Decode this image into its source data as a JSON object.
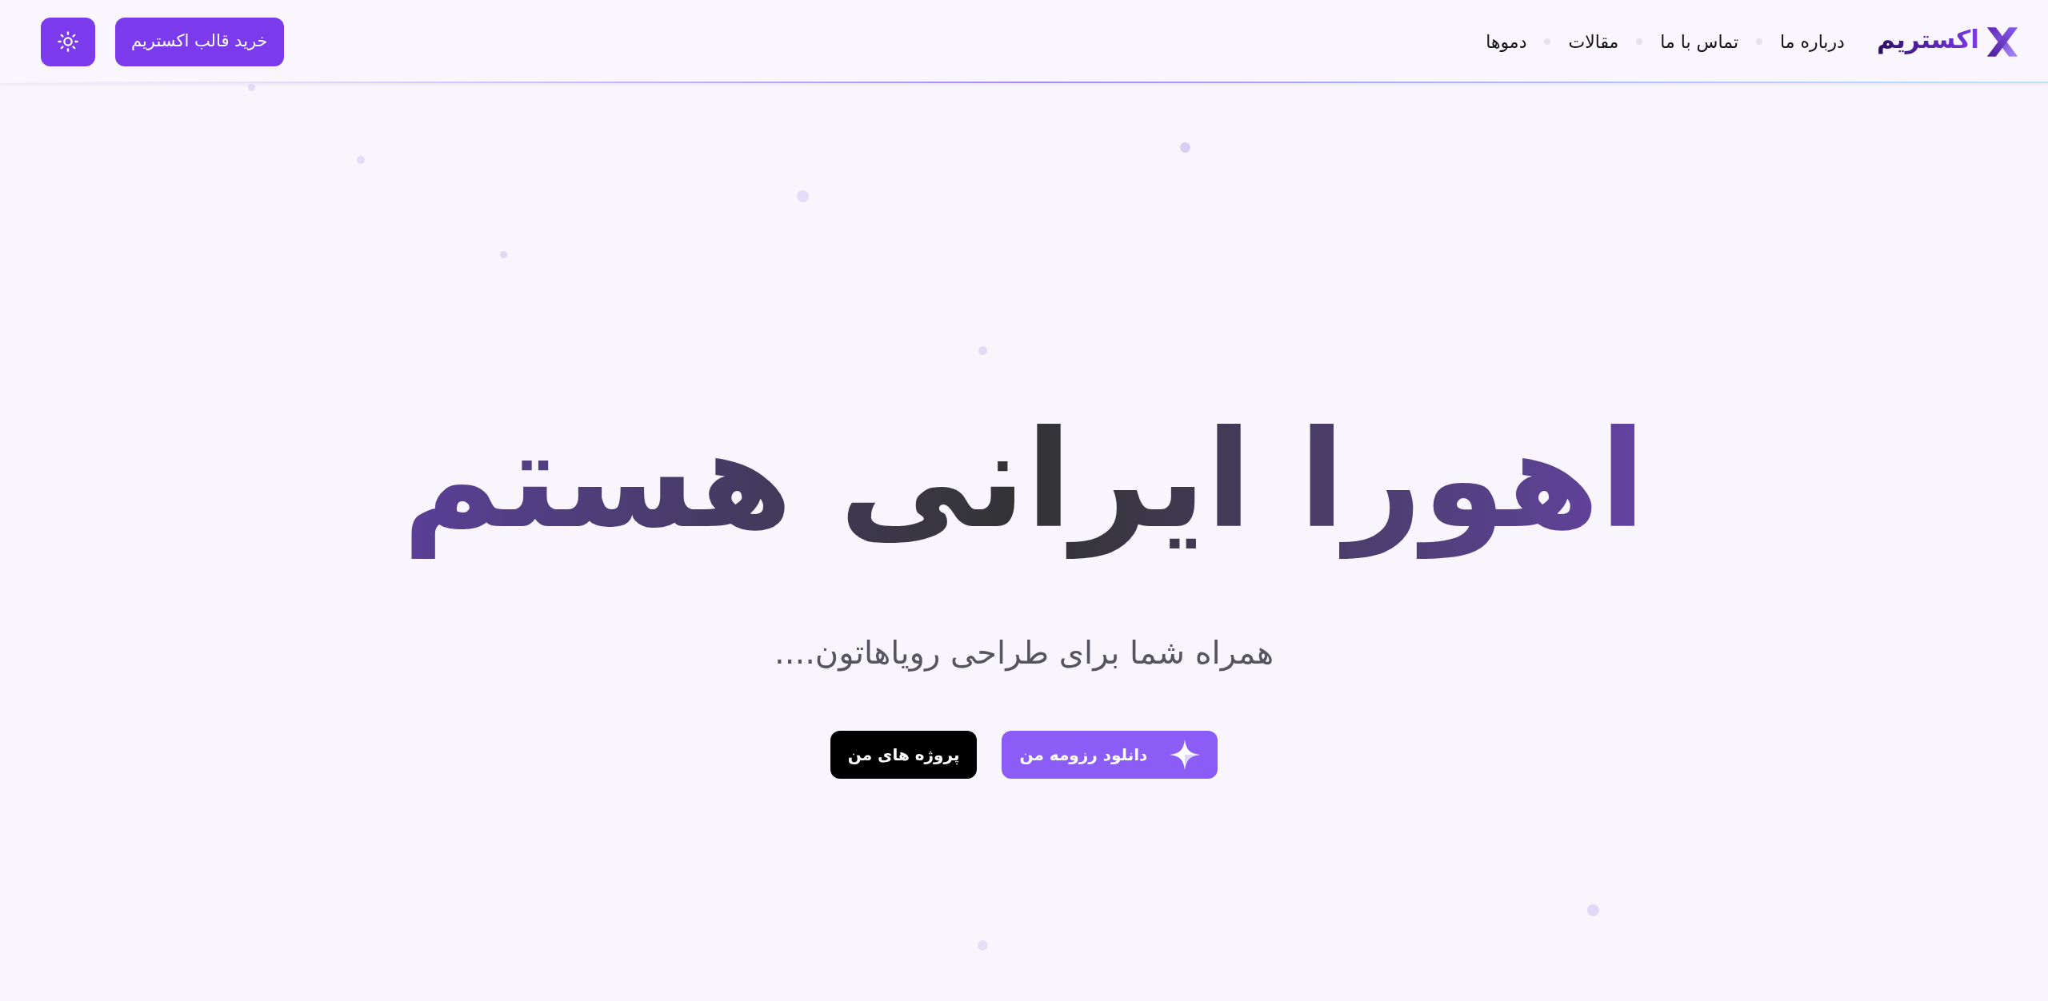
{
  "header": {
    "logo": {
      "text": "اکستریم"
    },
    "nav": [
      {
        "label": "درباره ما"
      },
      {
        "label": "تماس با ما"
      },
      {
        "label": "مقالات"
      },
      {
        "label": "دموها"
      }
    ],
    "buy_button": "خرید قالب اکستریم"
  },
  "hero": {
    "title": "اهورا ایرانی هستم",
    "subtitle": "همراه شما برای طراحی رویاهاتون....",
    "buttons": [
      {
        "label": "دانلود رزومه من",
        "kind": "primary"
      },
      {
        "label": "پروژه های من",
        "kind": "dark"
      }
    ]
  }
}
